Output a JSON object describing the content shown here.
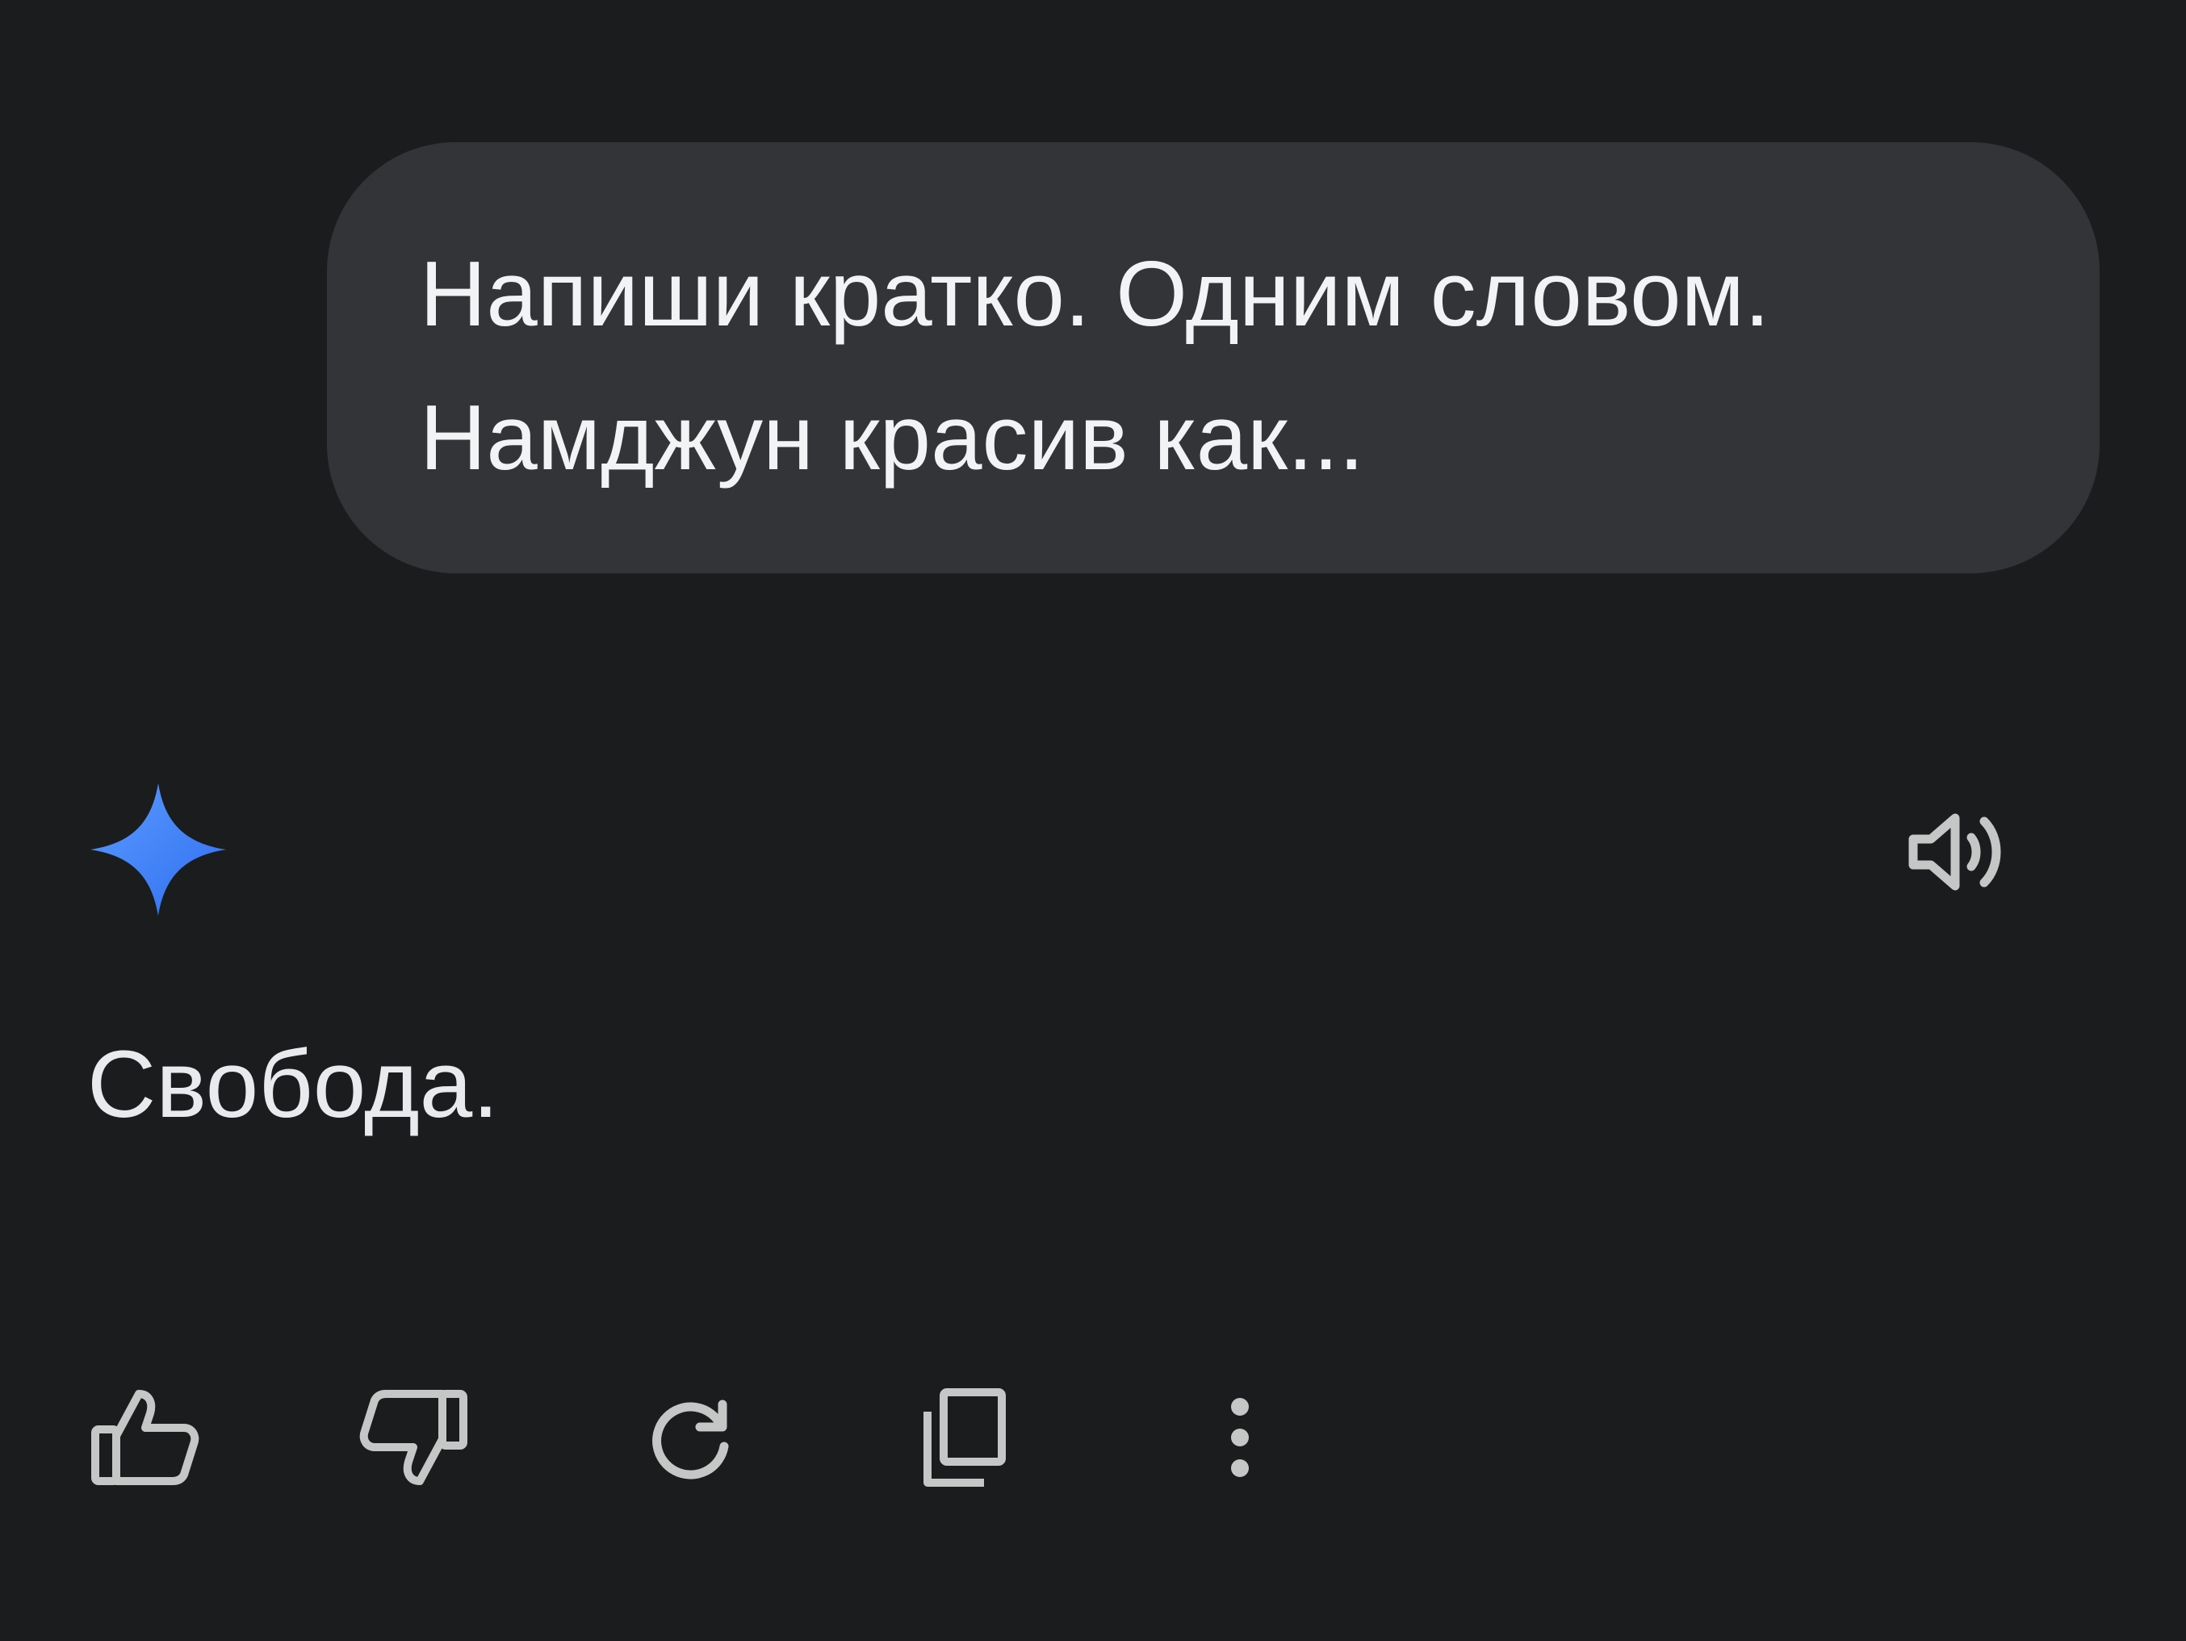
{
  "conversation": {
    "user_message": {
      "lines": [
        "Напиши кратко. Одним словом.",
        "Намджун красив как..."
      ]
    },
    "assistant": {
      "avatar_icon": "gemini-sparkle-icon",
      "speaker_icon": "speaker-icon",
      "response": "Свобода."
    }
  },
  "actions": [
    {
      "icon": "thumbs-up-icon",
      "name": "like-button"
    },
    {
      "icon": "thumbs-down-icon",
      "name": "dislike-button"
    },
    {
      "icon": "regenerate-icon",
      "name": "regenerate-button"
    },
    {
      "icon": "copy-icon",
      "name": "copy-button"
    },
    {
      "icon": "more-vertical-icon",
      "name": "more-options-button"
    }
  ],
  "colors": {
    "background": "#1b1c1e",
    "bubble": "#333437",
    "text": "#e8eaed",
    "icon": "#c4c7c5",
    "accent_start": "#4e8df5",
    "accent_end": "#2e6ff2"
  }
}
